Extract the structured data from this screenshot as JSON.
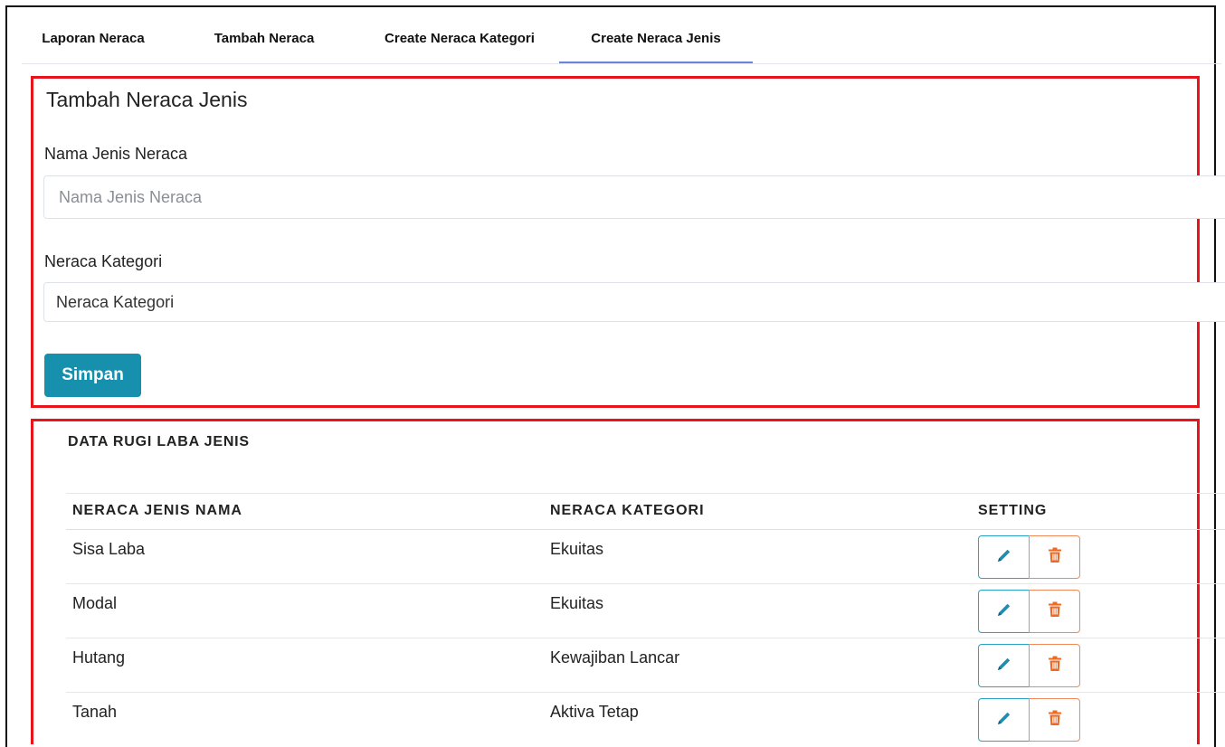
{
  "tabs": [
    {
      "label": "Laporan Neraca"
    },
    {
      "label": "Tambah Neraca"
    },
    {
      "label": "Create Neraca Kategori"
    },
    {
      "label": "Create Neraca Jenis",
      "active": true
    }
  ],
  "form": {
    "title": "Tambah Neraca Jenis",
    "name_label": "Nama Jenis Neraca",
    "name_placeholder": "Nama Jenis Neraca",
    "name_value": "",
    "category_label": "Neraca Kategori",
    "category_selected": "Neraca Kategori",
    "save_label": "Simpan"
  },
  "table": {
    "title": "DATA RUGI LABA JENIS",
    "columns": [
      "NERACA JENIS NAMA",
      "NERACA KATEGORI",
      "SETTING"
    ],
    "rows": [
      {
        "name": "Sisa Laba",
        "category": "Ekuitas"
      },
      {
        "name": "Modal",
        "category": "Ekuitas"
      },
      {
        "name": "Hutang",
        "category": "Kewajiban Lancar"
      },
      {
        "name": "Tanah",
        "category": "Aktiva Tetap"
      }
    ]
  },
  "icons": {
    "edit": "pencil-icon",
    "delete": "trash-icon"
  },
  "colors": {
    "accent": "#1790ad",
    "edit_border": "#2ba3c7",
    "delete_border": "#f08a5a",
    "edit_icon": "#1a8fb3",
    "delete_icon": "#ee6a24",
    "annotation_red": "#e8141c",
    "active_tab_underline": "#6c83d6"
  }
}
